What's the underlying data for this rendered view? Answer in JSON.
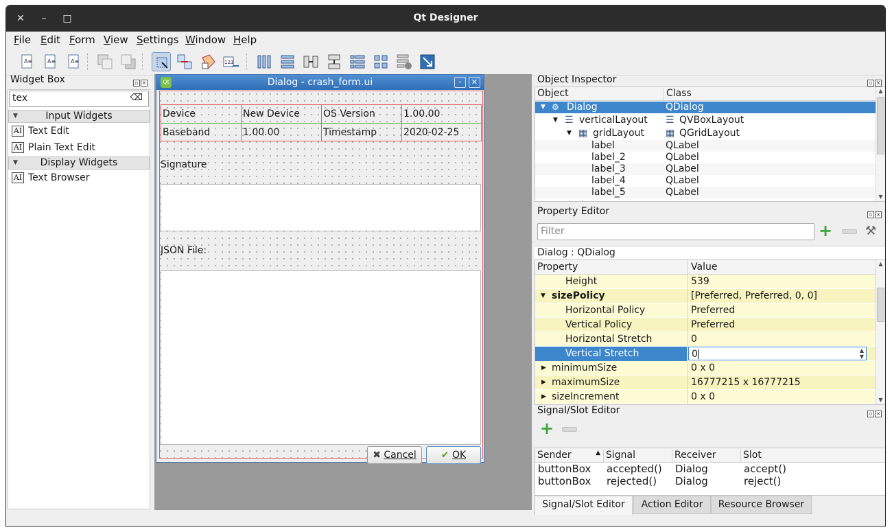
{
  "window": {
    "title": "Qt Designer",
    "close": "✕",
    "minimize": "–",
    "maximize": "□"
  },
  "menu": [
    "File",
    "Edit",
    "Form",
    "View",
    "Settings",
    "Window",
    "Help"
  ],
  "widget_box": {
    "title": "Widget Box",
    "search_value": "tex",
    "categories": [
      {
        "label": "Input Widgets",
        "items": [
          "Text Edit",
          "Plain Text Edit"
        ]
      },
      {
        "label": "Display Widgets",
        "items": [
          "Text Browser"
        ]
      }
    ],
    "icon_glyph": "AI"
  },
  "form": {
    "title": "Dialog - crash_form.ui",
    "grid": [
      [
        "Device",
        "New Device",
        "OS Version",
        "1.00.00"
      ],
      [
        "Baseband",
        "1.00.00",
        "Timestamp",
        "2020-02-25"
      ]
    ],
    "signature_label": "Signature",
    "json_label": "JSON File:",
    "cancel_label": "Cancel",
    "ok_label": "OK",
    "title_buttons": [
      "-",
      "✕"
    ]
  },
  "object_inspector": {
    "title": "Object Inspector",
    "columns": [
      "Object",
      "Class"
    ],
    "rows": [
      {
        "object": "Dialog",
        "class": "QDialog"
      },
      {
        "object": "verticalLayout",
        "class": "QVBoxLayout"
      },
      {
        "object": "gridLayout",
        "class": "QGridLayout"
      },
      {
        "object": "label",
        "class": "QLabel"
      },
      {
        "object": "label_2",
        "class": "QLabel"
      },
      {
        "object": "label_3",
        "class": "QLabel"
      },
      {
        "object": "label_4",
        "class": "QLabel"
      },
      {
        "object": "label_5",
        "class": "QLabel"
      }
    ]
  },
  "property_editor": {
    "title": "Property Editor",
    "filter_placeholder": "Filter",
    "object_class": "Dialog : QDialog",
    "columns": [
      "Property",
      "Value"
    ],
    "rows": [
      {
        "name": "Height",
        "value": "539"
      },
      {
        "name": "sizePolicy",
        "value": "[Preferred, Preferred, 0, 0]"
      },
      {
        "name": "Horizontal Policy",
        "value": "Preferred"
      },
      {
        "name": "Vertical Policy",
        "value": "Preferred"
      },
      {
        "name": "Horizontal Stretch",
        "value": "0"
      },
      {
        "name": "Vertical Stretch",
        "value": "0"
      },
      {
        "name": "minimumSize",
        "value": "0 x 0"
      },
      {
        "name": "maximumSize",
        "value": "16777215 x 16777215"
      },
      {
        "name": "sizeIncrement",
        "value": "0 x 0"
      }
    ]
  },
  "signal_slot": {
    "title": "Signal/Slot Editor",
    "columns": [
      "Sender",
      "Signal",
      "Receiver",
      "Slot"
    ],
    "rows": [
      [
        "buttonBox",
        "accepted()",
        "Dialog",
        "accept()"
      ],
      [
        "buttonBox",
        "rejected()",
        "Dialog",
        "reject()"
      ]
    ]
  },
  "tabs": [
    "Signal/Slot Editor",
    "Action Editor",
    "Resource Browser"
  ],
  "colors": {
    "selection": "#3d86cc",
    "property_bg": "#fdfbd3",
    "layout_border": "#e06060"
  }
}
